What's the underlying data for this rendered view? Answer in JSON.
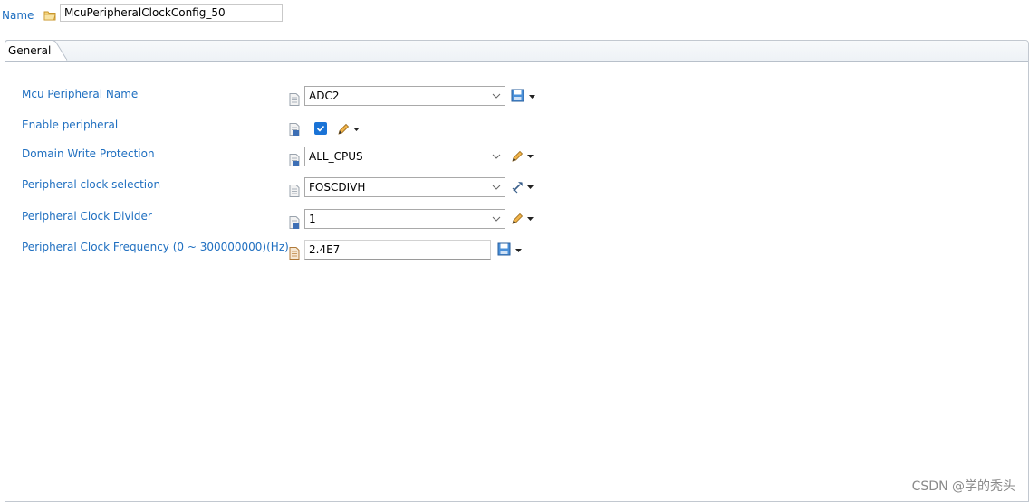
{
  "header": {
    "name_label": "Name",
    "name_value": "McuPeripheralClockConfig_50"
  },
  "tabs": [
    {
      "label": "General",
      "active": true
    }
  ],
  "form": {
    "rows": [
      {
        "label": "Mcu Peripheral Name",
        "control": "select",
        "value": "ADC2",
        "action_icon": "save-icon"
      },
      {
        "label": "Enable peripheral",
        "control": "checkbox",
        "checked": true,
        "action_icon": "pencil-icon"
      },
      {
        "label": "Domain Write Protection",
        "control": "select",
        "value": "ALL_CPUS",
        "action_icon": "pencil-icon"
      },
      {
        "label": "Peripheral clock selection",
        "control": "select",
        "value": "FOSCDIVH",
        "action_icon": "link-icon"
      },
      {
        "label": "Peripheral Clock Divider",
        "control": "select",
        "value": "1",
        "action_icon": "pencil-icon"
      },
      {
        "label": "Peripheral Clock Frequency (0 ~ 300000000)(Hz)",
        "control": "text",
        "value": "2.4E7",
        "action_icon": "save-icon"
      }
    ]
  },
  "watermark": "CSDN @学的秃头",
  "colors": {
    "label_blue": "#1f6fc0",
    "checkbox_blue": "#1a73d6",
    "border": "#a9a9a9"
  }
}
